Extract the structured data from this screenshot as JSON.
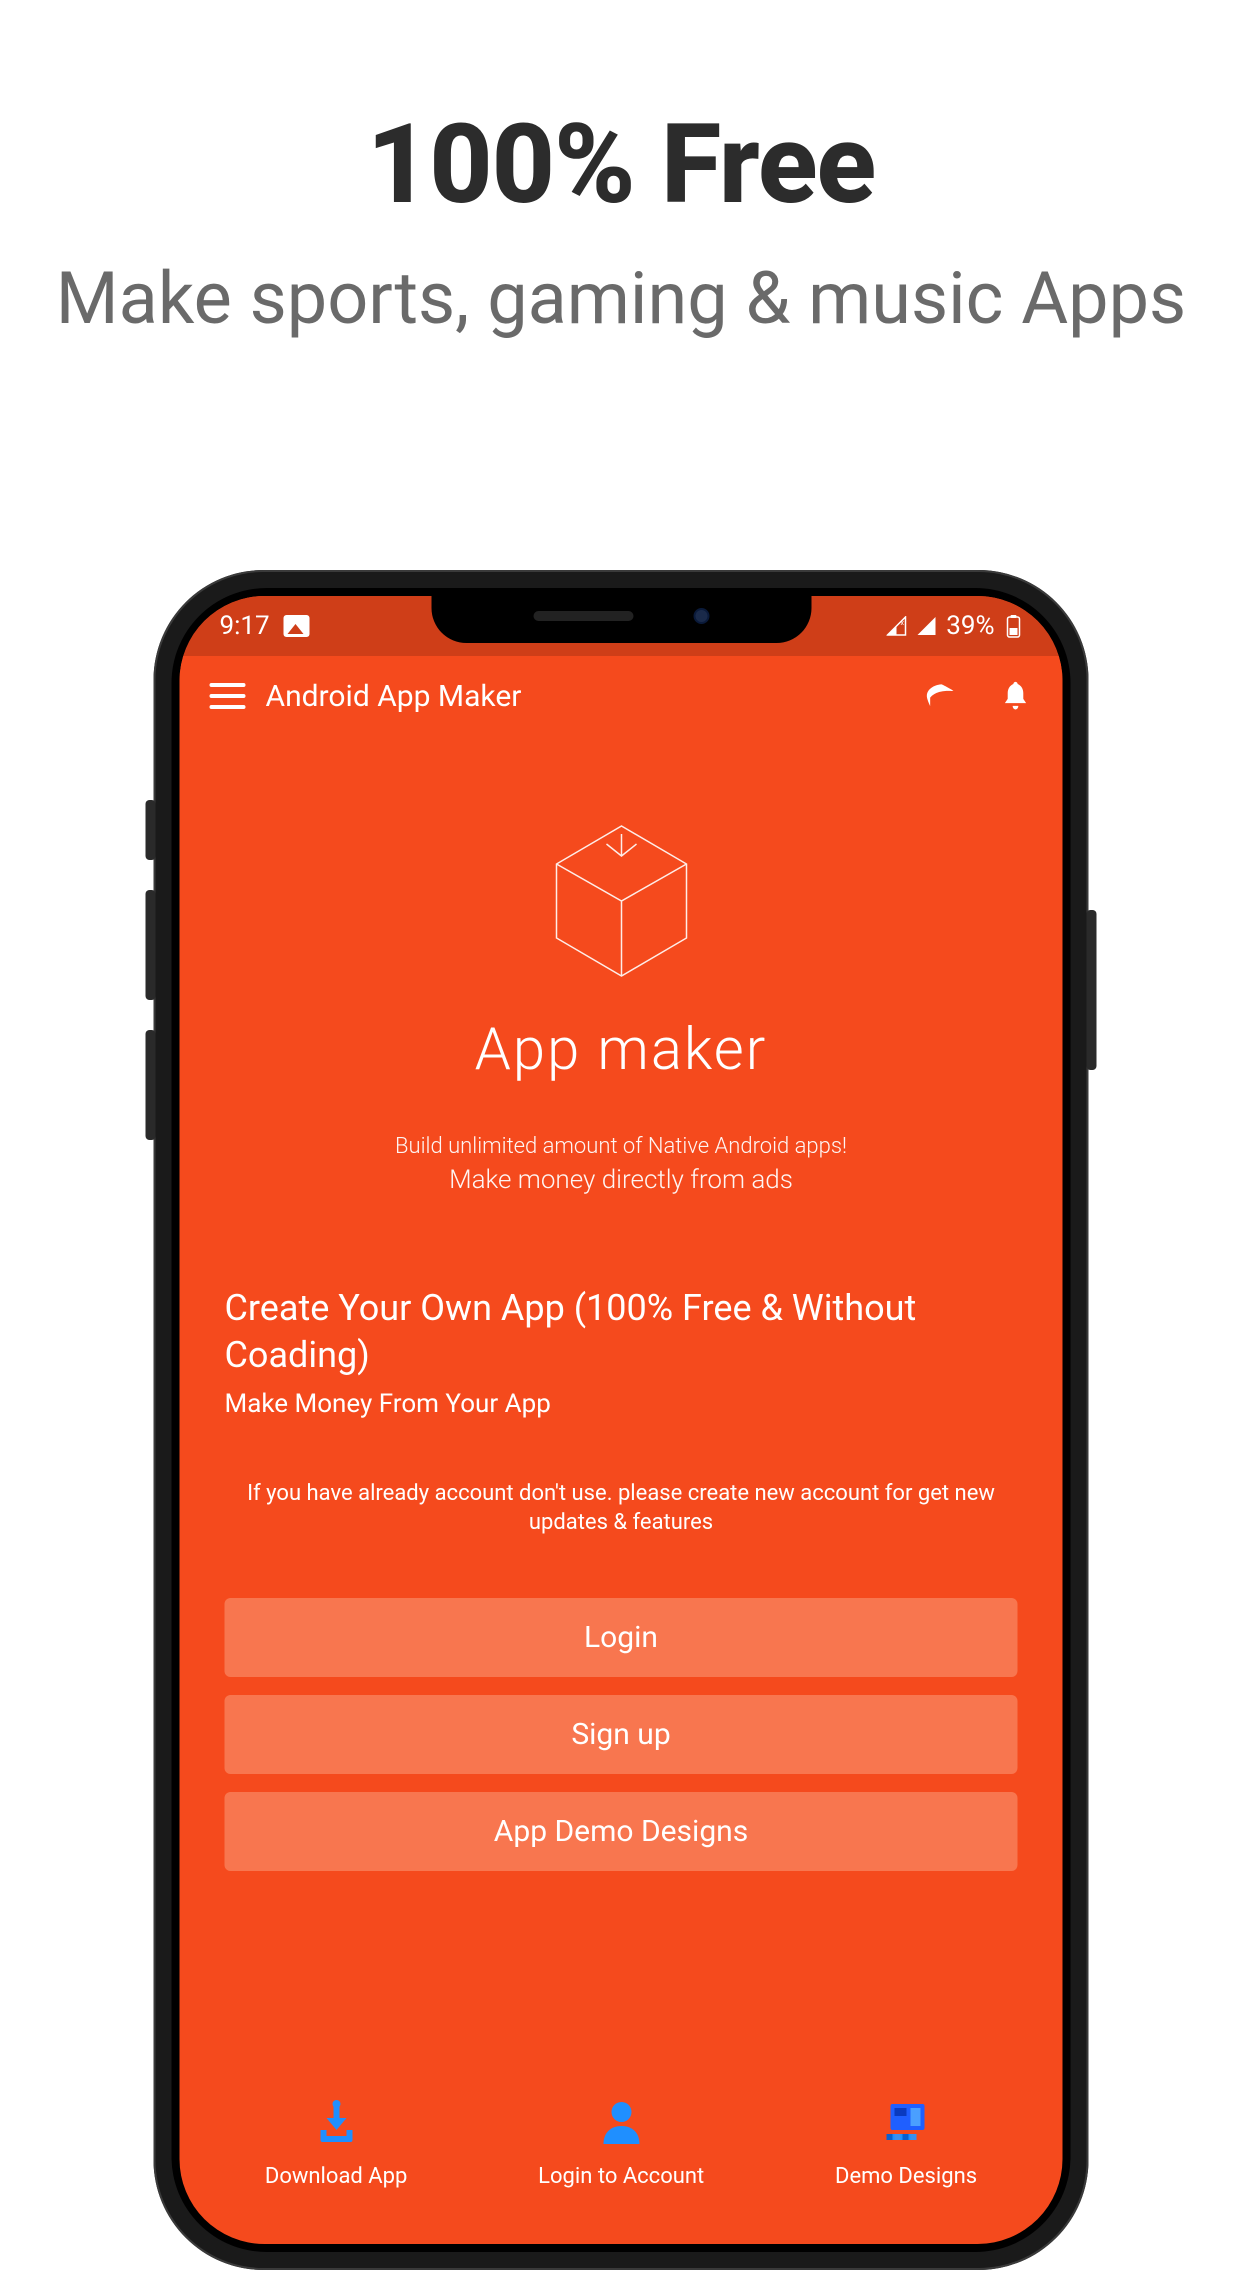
{
  "marketing": {
    "title": "100% Free",
    "subtitle": "Make sports, gaming & music Apps"
  },
  "status": {
    "time": "9:17",
    "battery": "39%"
  },
  "header": {
    "title": "Android App Maker"
  },
  "hero": {
    "title": "App maker",
    "line1": "Build unlimited amount of Native Android apps!",
    "line2": "Make money directly from ads"
  },
  "content": {
    "headline": "Create Your Own App  (100% Free & Without Coading)",
    "sub": "Make Money From Your App",
    "hint": "If you have already account don't use. please create new account for get new updates & features"
  },
  "buttons": {
    "login": "Login",
    "signup": "Sign up",
    "demo": "App Demo Designs"
  },
  "nav": {
    "download": "Download App",
    "login": "Login to Account",
    "demo": "Demo Designs"
  },
  "colors": {
    "primary": "#f54a1d",
    "primaryDark": "#cf3e18",
    "buttonBg": "#f8764f",
    "iconBlue": "#1f8fff"
  }
}
